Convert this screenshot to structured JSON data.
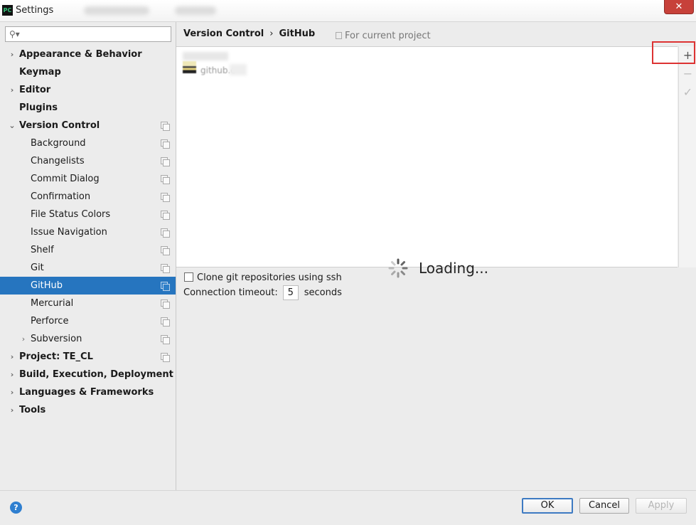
{
  "window": {
    "title": "Settings",
    "app_logo": "PC",
    "close_glyph": "✕"
  },
  "sidebar": {
    "search_placeholder": "",
    "items": [
      {
        "label": "Appearance & Behavior",
        "level": 0,
        "bold": true,
        "arrow": "›",
        "copy": false
      },
      {
        "label": "Keymap",
        "level": 0,
        "bold": true,
        "arrow": "",
        "copy": false
      },
      {
        "label": "Editor",
        "level": 0,
        "bold": true,
        "arrow": "›",
        "copy": false
      },
      {
        "label": "Plugins",
        "level": 0,
        "bold": true,
        "arrow": "",
        "copy": false
      },
      {
        "label": "Version Control",
        "level": 0,
        "bold": true,
        "arrow": "⌄",
        "copy": true
      },
      {
        "label": "Background",
        "level": 1,
        "bold": false,
        "arrow": "",
        "copy": true
      },
      {
        "label": "Changelists",
        "level": 1,
        "bold": false,
        "arrow": "",
        "copy": true
      },
      {
        "label": "Commit Dialog",
        "level": 1,
        "bold": false,
        "arrow": "",
        "copy": true
      },
      {
        "label": "Confirmation",
        "level": 1,
        "bold": false,
        "arrow": "",
        "copy": true
      },
      {
        "label": "File Status Colors",
        "level": 1,
        "bold": false,
        "arrow": "",
        "copy": true
      },
      {
        "label": "Issue Navigation",
        "level": 1,
        "bold": false,
        "arrow": "",
        "copy": true
      },
      {
        "label": "Shelf",
        "level": 1,
        "bold": false,
        "arrow": "",
        "copy": true
      },
      {
        "label": "Git",
        "level": 1,
        "bold": false,
        "arrow": "",
        "copy": true
      },
      {
        "label": "GitHub",
        "level": 1,
        "bold": false,
        "arrow": "",
        "copy": true,
        "selected": true
      },
      {
        "label": "Mercurial",
        "level": 1,
        "bold": false,
        "arrow": "",
        "copy": true
      },
      {
        "label": "Perforce",
        "level": 1,
        "bold": false,
        "arrow": "",
        "copy": true
      },
      {
        "label": "Subversion",
        "level": 1,
        "bold": false,
        "arrow": "›",
        "copy": true
      },
      {
        "label": "Project: TE_CL",
        "level": 0,
        "bold": true,
        "arrow": "›",
        "copy": true
      },
      {
        "label": "Build, Execution, Deployment",
        "level": 0,
        "bold": true,
        "arrow": "›",
        "copy": false
      },
      {
        "label": "Languages & Frameworks",
        "level": 0,
        "bold": true,
        "arrow": "›",
        "copy": false
      },
      {
        "label": "Tools",
        "level": 0,
        "bold": true,
        "arrow": "›",
        "copy": false
      }
    ]
  },
  "main": {
    "breadcrumb": {
      "parent": "Version Control",
      "separator": "›",
      "current": "GitHub"
    },
    "scope_label": "For current project",
    "account_host": "github.c",
    "toolbar": {
      "add": "+",
      "remove": "−",
      "default": "✓"
    },
    "loading_text": "Loading...",
    "clone_ssh_label": "Clone git repositories using ssh",
    "clone_ssh_checked": false,
    "timeout_label": "Connection timeout:",
    "timeout_value": "5",
    "timeout_unit": "seconds"
  },
  "footer": {
    "help": "?",
    "ok": "OK",
    "cancel": "Cancel",
    "apply": "Apply"
  }
}
